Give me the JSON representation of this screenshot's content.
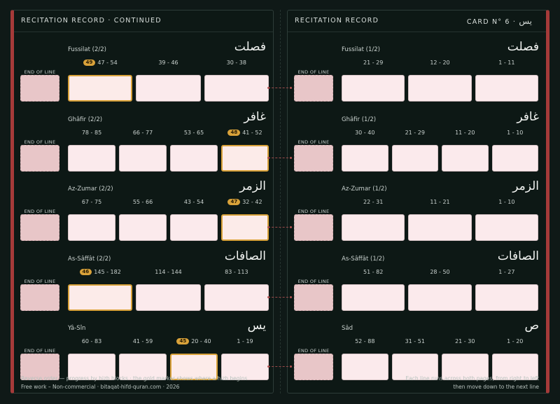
{
  "left_page": {
    "title": "RECITATION RECORD · CONTINUED",
    "sections": [
      {
        "name": "Fussilat (2/2)",
        "arabic": "فصلت",
        "end_label": "END OF LINE",
        "blocks": [
          {
            "label": "47 - 54",
            "badge": "49",
            "gold": true
          },
          {
            "label": "39 - 46"
          },
          {
            "label": "30 - 38"
          }
        ]
      },
      {
        "name": "Ghâfir (2/2)",
        "arabic": "غافر",
        "end_label": "END OF LINE",
        "blocks": [
          {
            "label": "78 - 85"
          },
          {
            "label": "66 - 77"
          },
          {
            "label": "53 - 65"
          },
          {
            "label": "41 - 52",
            "badge": "48",
            "gold": true
          }
        ]
      },
      {
        "name": "Az-Zumar (2/2)",
        "arabic": "الزمر",
        "end_label": "END OF LINE",
        "blocks": [
          {
            "label": "67 - 75"
          },
          {
            "label": "55 - 66"
          },
          {
            "label": "43 - 54"
          },
          {
            "label": "32 - 42",
            "badge": "47",
            "gold": true
          }
        ]
      },
      {
        "name": "As-Sâffât (2/2)",
        "arabic": "الصافات",
        "end_label": "END OF LINE",
        "blocks": [
          {
            "label": "145 - 182",
            "badge": "46",
            "gold": true
          },
          {
            "label": "114 - 144"
          },
          {
            "label": "83 - 113"
          }
        ]
      },
      {
        "name": "Yâ-Sîn",
        "arabic": "يس",
        "end_label": "END OF LINE",
        "blocks": [
          {
            "label": "60 - 83"
          },
          {
            "label": "41 - 59"
          },
          {
            "label": "20 - 40",
            "badge": "45",
            "gold": true
          },
          {
            "label": "1 - 19"
          }
        ]
      }
    ],
    "footer_line1": "Reverse order — progress by hizb blocks · the gold marker shows where a hizb begins",
    "footer_line2": "Free work – Non-commercial · bitaqat-hifd-quran.com · 2026"
  },
  "right_page": {
    "title": "RECITATION RECORD",
    "card_label": "CARD N° 6 ·",
    "card_arabic": "يس",
    "sections": [
      {
        "name": "Fussilat (1/2)",
        "arabic": "فصلت",
        "end_label": "END OF LINE",
        "blocks": [
          {
            "label": "21 - 29"
          },
          {
            "label": "12 - 20"
          },
          {
            "label": "1 - 11"
          }
        ]
      },
      {
        "name": "Ghâfir (1/2)",
        "arabic": "غافر",
        "end_label": "END OF LINE",
        "blocks": [
          {
            "label": "30 - 40"
          },
          {
            "label": "21 - 29"
          },
          {
            "label": "11 - 20"
          },
          {
            "label": "1 - 10"
          }
        ]
      },
      {
        "name": "Az-Zumar (1/2)",
        "arabic": "الزمر",
        "end_label": "END OF LINE",
        "blocks": [
          {
            "label": "22 - 31"
          },
          {
            "label": "11 - 21"
          },
          {
            "label": "1 - 10"
          }
        ]
      },
      {
        "name": "As-Sâffât (1/2)",
        "arabic": "الصافات",
        "end_label": "END OF LINE",
        "blocks": [
          {
            "label": "51 - 82"
          },
          {
            "label": "28 - 50"
          },
          {
            "label": "1 - 27"
          }
        ]
      },
      {
        "name": "Sâd",
        "arabic": "ص",
        "end_label": "END OF LINE",
        "blocks": [
          {
            "label": "52 - 88"
          },
          {
            "label": "31 - 51"
          },
          {
            "label": "21 - 30"
          },
          {
            "label": "1 - 20"
          }
        ]
      }
    ],
    "footer_line1": "Each line runs across both pages, from right to left",
    "footer_line2": "then move down to the next line"
  },
  "colors": {
    "accent_red": "#a53a39",
    "gold": "#d9a23a",
    "block": "#fbeaec",
    "end_block": "#e8c6c8"
  }
}
